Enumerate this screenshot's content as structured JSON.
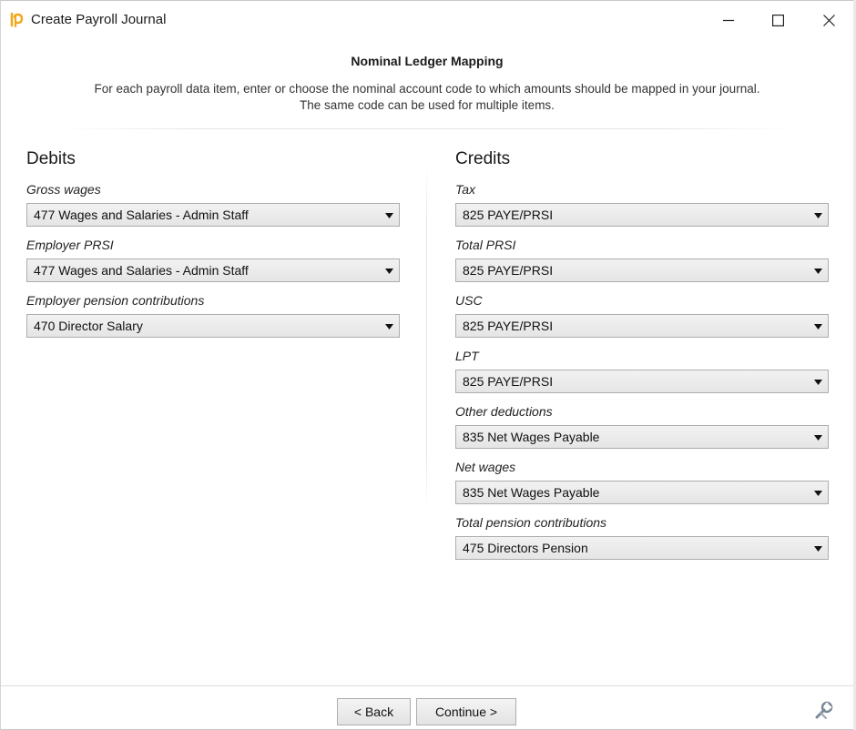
{
  "window": {
    "title": "Create Payroll Journal",
    "controls": {
      "minimize": "minimize-icon",
      "maximize": "maximize-icon",
      "close": "close-icon"
    }
  },
  "header": {
    "title": "Nominal Ledger Mapping",
    "description_line1": "For each payroll data item, enter or choose the nominal account code to which amounts should be mapped in your journal.",
    "description_line2": "The same code can be used for multiple items."
  },
  "debits": {
    "title": "Debits",
    "fields": [
      {
        "label": "Gross wages",
        "value": "477 Wages and Salaries - Admin Staff"
      },
      {
        "label": "Employer PRSI",
        "value": "477 Wages and Salaries - Admin Staff"
      },
      {
        "label": "Employer pension contributions",
        "value": "470 Director Salary"
      }
    ]
  },
  "credits": {
    "title": "Credits",
    "fields": [
      {
        "label": "Tax",
        "value": "825 PAYE/PRSI"
      },
      {
        "label": "Total PRSI",
        "value": "825 PAYE/PRSI"
      },
      {
        "label": "USC",
        "value": "825 PAYE/PRSI"
      },
      {
        "label": "LPT",
        "value": "825 PAYE/PRSI"
      },
      {
        "label": "Other deductions",
        "value": "835 Net Wages Payable"
      },
      {
        "label": "Net wages",
        "value": "835 Net Wages Payable"
      },
      {
        "label": "Total pension contributions",
        "value": "475 Directors Pension"
      }
    ]
  },
  "footer": {
    "back_label": "< Back",
    "continue_label": "Continue >",
    "tools_icon": "wrench-icon"
  },
  "colors": {
    "logo": "#f0a81c",
    "combo_border": "#adadad",
    "combo_fill": "#e9e9e9"
  }
}
